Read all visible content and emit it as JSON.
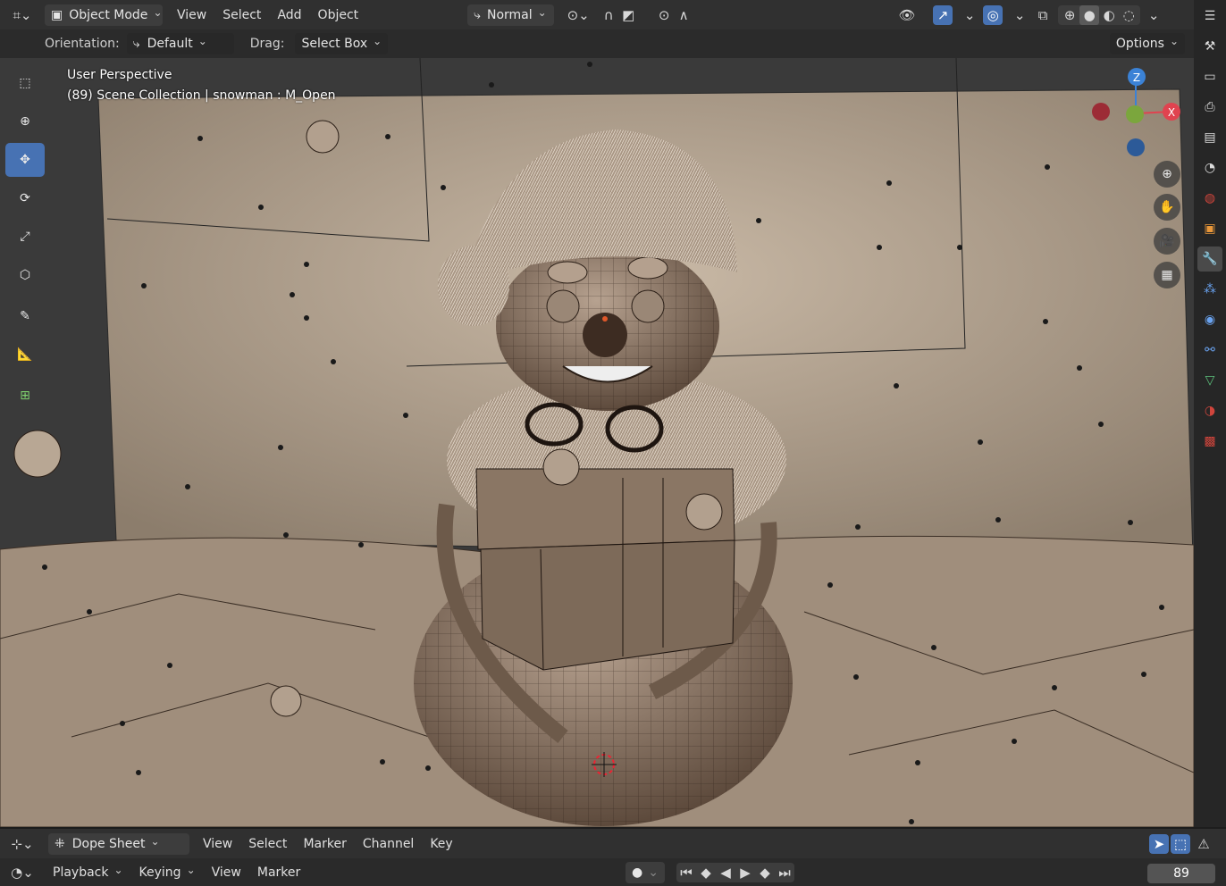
{
  "header": {
    "mode": "Object Mode",
    "menus": [
      "View",
      "Select",
      "Add",
      "Object"
    ],
    "transform_orientation": "Normal"
  },
  "tool_settings": {
    "orientation_label": "Orientation:",
    "orientation_value": "Default",
    "drag_label": "Drag:",
    "drag_value": "Select Box",
    "options_label": "Options"
  },
  "viewport": {
    "perspective": "User Perspective",
    "collection": "(89) Scene Collection | snowman : M_Open"
  },
  "gizmo": {
    "z": "Z",
    "x": "X"
  },
  "toolbar_icons": [
    "select-box-icon",
    "cursor-icon",
    "move-icon",
    "rotate-icon",
    "scale-icon",
    "transform-icon",
    "annotate-icon",
    "measure-icon",
    "add-cube-icon"
  ],
  "properties_icons": [
    "tool-icon",
    "render-icon",
    "output-icon",
    "view-layer-icon",
    "scene-icon",
    "world-icon",
    "object-icon",
    "modifier-icon",
    "particles-icon",
    "physics-icon",
    "constraints-icon",
    "data-icon",
    "material-icon",
    "texture-icon"
  ],
  "dope_sheet": {
    "editor": "Dope Sheet",
    "menus": [
      "View",
      "Select",
      "Marker",
      "Channel",
      "Key"
    ]
  },
  "timeline": {
    "playback": "Playback",
    "keying": "Keying",
    "menus": [
      "View",
      "Marker"
    ],
    "current_frame": "89"
  },
  "colors": {
    "accent": "#4772b3",
    "x_axis": "#e0434f",
    "y_axis": "#8bc34a",
    "z_axis": "#3b82d6"
  }
}
